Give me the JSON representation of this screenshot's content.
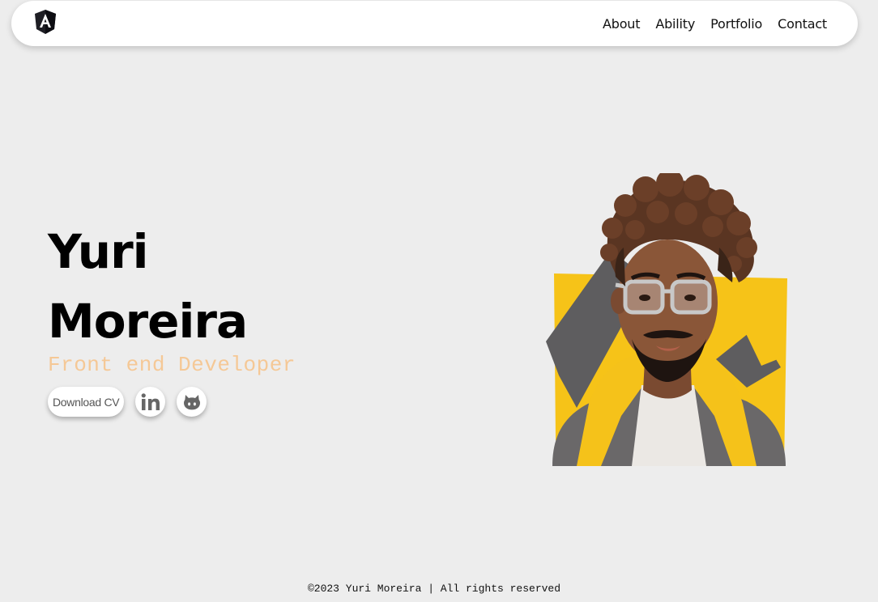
{
  "header": {
    "logo_icon": "angular-logo-icon",
    "nav": [
      {
        "label": "About"
      },
      {
        "label": "Ability"
      },
      {
        "label": "Portfolio"
      },
      {
        "label": "Contact"
      }
    ]
  },
  "hero": {
    "first_name": "Yuri",
    "last_name": "Moreira",
    "role": "Front end Developer",
    "download_cv": "Download CV",
    "social_icons": [
      "linkedin-icon",
      "github-icon"
    ]
  },
  "footer": {
    "text": "©2023 Yuri Moreira | All rights reserved"
  },
  "colors": {
    "background": "#ededed",
    "role_text": "#f5c896",
    "accent_yellow": "#f6c318",
    "shape_gray": "#5e5d5f"
  }
}
